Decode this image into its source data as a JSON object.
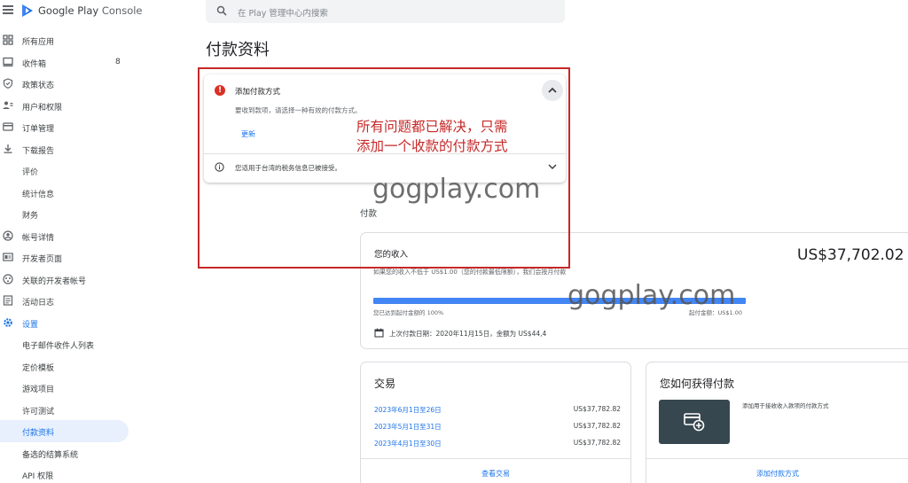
{
  "brand": {
    "title_main": "Google Play",
    "title_sub": "Console"
  },
  "search": {
    "placeholder": "在 Play 管理中心内搜索"
  },
  "page": {
    "title": "付款资料"
  },
  "sidebar": {
    "items": [
      {
        "label": "所有应用",
        "icon": "grid-icon"
      },
      {
        "label": "收件箱",
        "icon": "inbox-icon",
        "count": "8"
      },
      {
        "label": "政策状态",
        "icon": "shield-icon"
      },
      {
        "label": "用户和权限",
        "icon": "users-icon"
      },
      {
        "label": "订单管理",
        "icon": "card-icon"
      },
      {
        "label": "下载报告",
        "icon": "download-icon"
      },
      {
        "label": "评价"
      },
      {
        "label": "统计信息"
      },
      {
        "label": "财务"
      },
      {
        "label": "帐号详情",
        "icon": "account-icon"
      },
      {
        "label": "开发者页面",
        "icon": "page-icon"
      },
      {
        "label": "关联的开发者帐号",
        "icon": "link-icon"
      },
      {
        "label": "活动日志",
        "icon": "log-icon"
      },
      {
        "label": "设置",
        "icon": "gear-icon"
      },
      {
        "label": "电子邮件收件人列表"
      },
      {
        "label": "定价模板"
      },
      {
        "label": "游戏项目"
      },
      {
        "label": "许可测试"
      },
      {
        "label": "付款资料"
      },
      {
        "label": "备选的结算系统"
      },
      {
        "label": "API 权限"
      }
    ]
  },
  "alerts": {
    "error": {
      "title": "添加付款方式",
      "description": "要收到款项，请选择一种有效的付款方式。",
      "link": "更新"
    },
    "info": {
      "text": "您适用于台湾的税务信息已被接受。"
    }
  },
  "payments": {
    "heading": "付款",
    "income": {
      "title": "您的收入",
      "amount": "US$37,702.02",
      "note": "如果您的收入不低于 US$1.00（您的付款最低限额），我们会按月付款",
      "progress": 1.0,
      "progress_left": "您已达到起付金额的 100%",
      "progress_right": "起付金额：US$1.00",
      "last_payment": "上次付款日期：2020年11月15日，金额为 US$44,4"
    },
    "transactions": {
      "title": "交易",
      "rows": [
        {
          "date": "2023年6月1日至26日",
          "amount": "US$37,782.82"
        },
        {
          "date": "2023年5月1日至31日",
          "amount": "US$37,782.82"
        },
        {
          "date": "2023年4月1日至30日",
          "amount": "US$37,782.82"
        }
      ],
      "link": "查看交易"
    },
    "how": {
      "title": "您如何获得付款",
      "text": "添加用于接收收入款项的付款方式",
      "link": "添加付款方式"
    }
  },
  "annotation": {
    "callout_line1": "所有问题都已解决，只需",
    "callout_line2": "添加一个收款的付款方式",
    "watermark": "gogplay.com"
  },
  "colors": {
    "accent": "#1a73e8",
    "error": "#d93025",
    "annotation": "#c62828",
    "progress": "#4285f4"
  }
}
